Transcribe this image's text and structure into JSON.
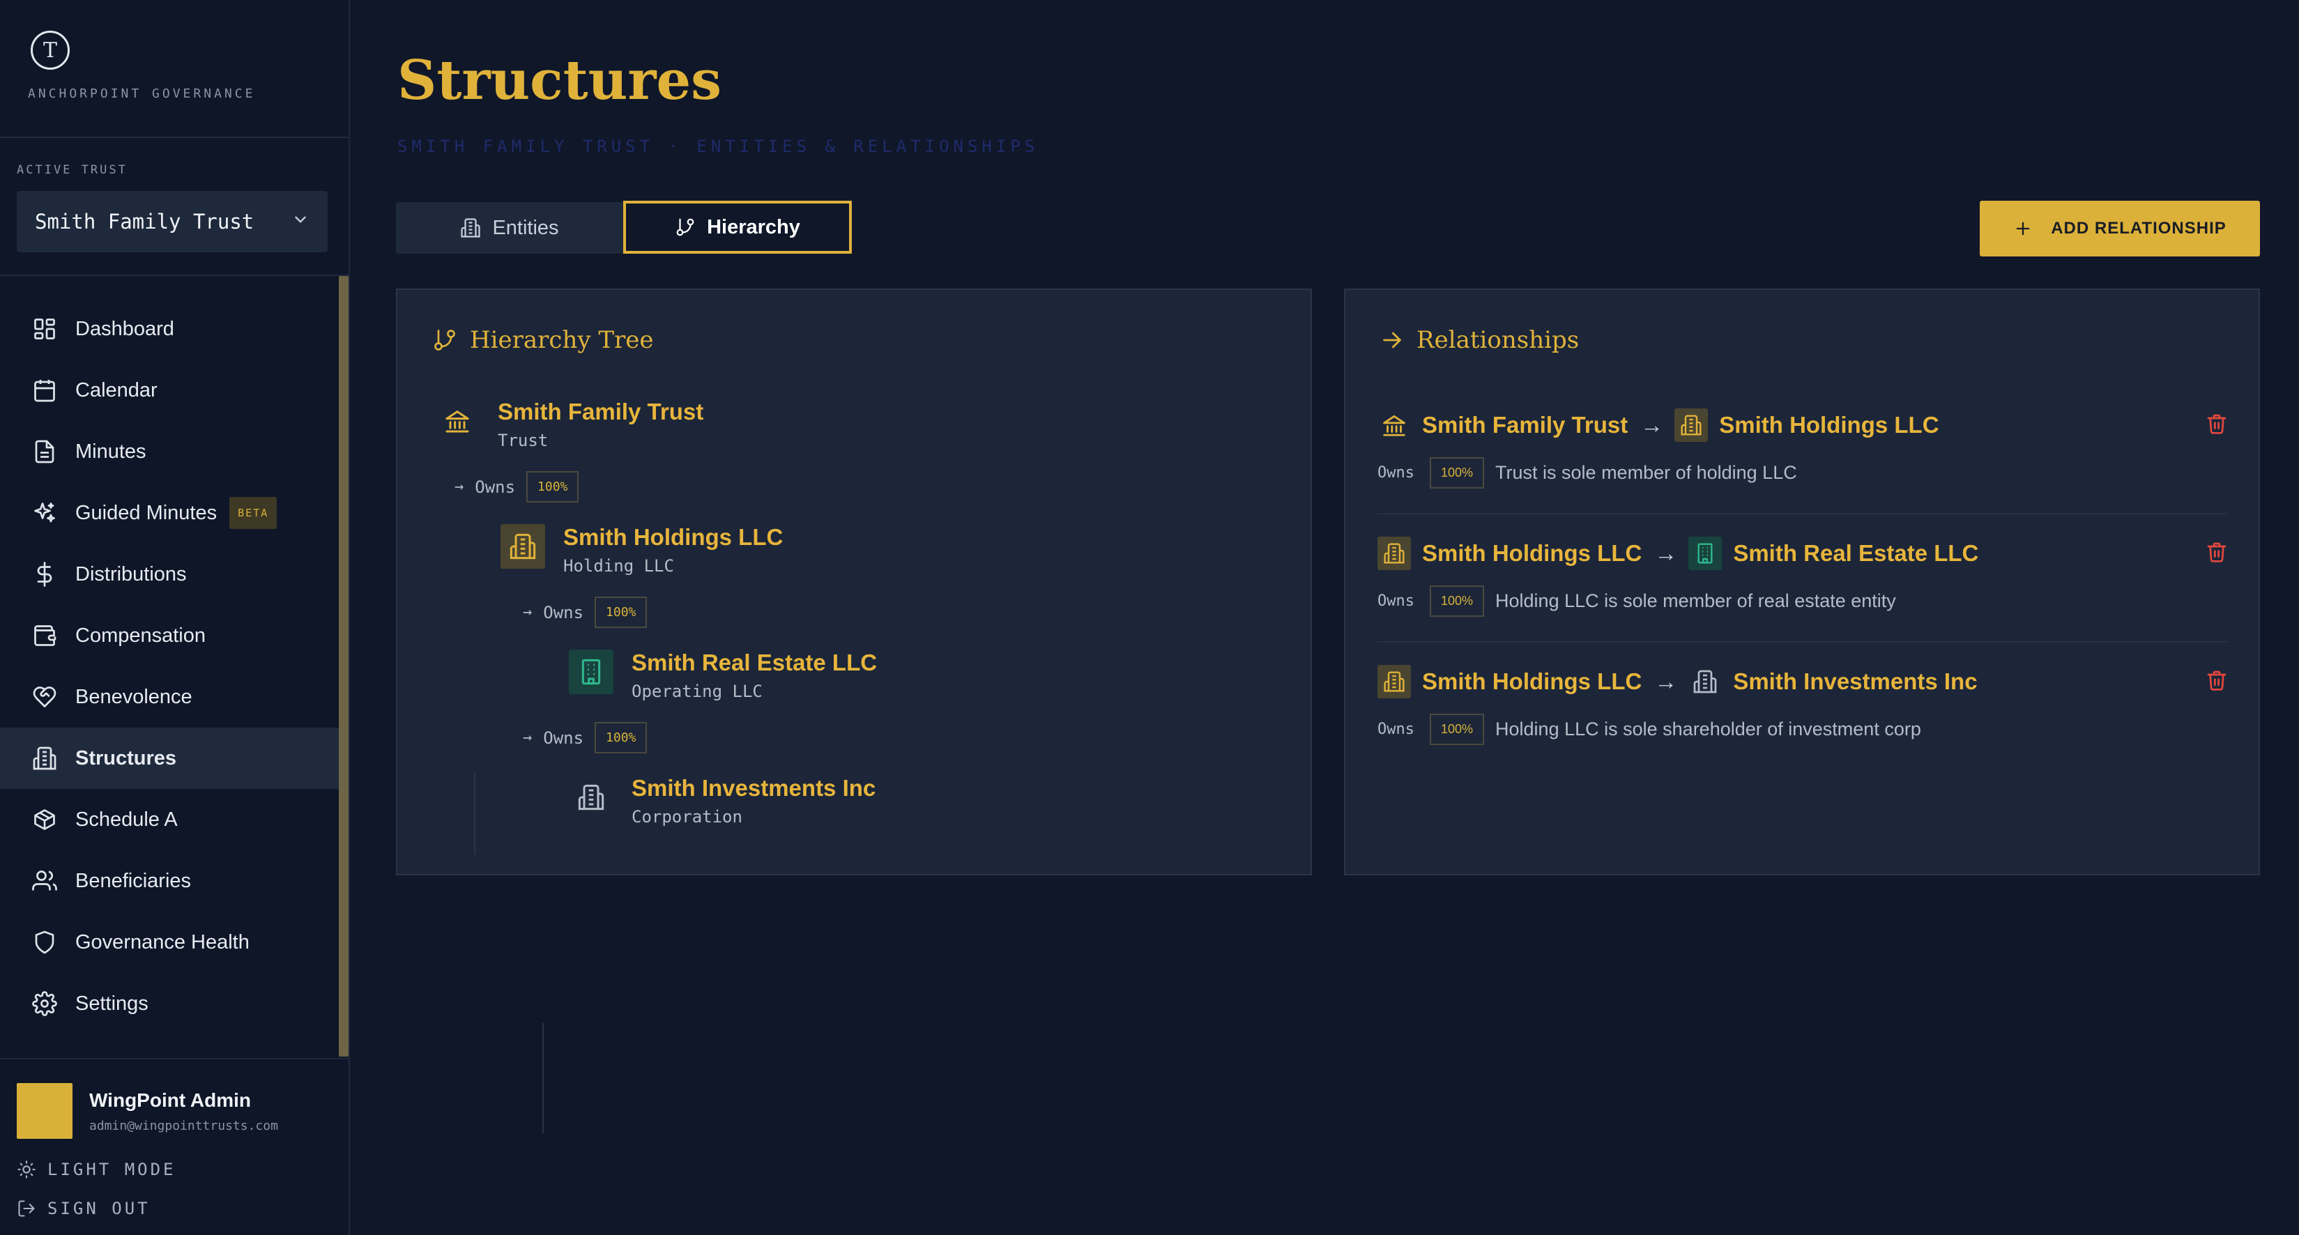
{
  "brand": {
    "logo_letter": "T",
    "name": "ANCHORPOINT GOVERNANCE"
  },
  "active_trust": {
    "label": "ACTIVE TRUST",
    "value": "Smith Family Trust"
  },
  "nav": [
    {
      "label": "Dashboard",
      "icon": "dashboard-icon"
    },
    {
      "label": "Calendar",
      "icon": "calendar-icon"
    },
    {
      "label": "Minutes",
      "icon": "document-icon"
    },
    {
      "label": "Guided Minutes",
      "icon": "sparkles-icon",
      "badge": "BETA"
    },
    {
      "label": "Distributions",
      "icon": "dollar-icon"
    },
    {
      "label": "Compensation",
      "icon": "wallet-icon"
    },
    {
      "label": "Benevolence",
      "icon": "heart-hand-icon"
    },
    {
      "label": "Structures",
      "icon": "building-icon",
      "active": true
    },
    {
      "label": "Schedule A",
      "icon": "package-icon"
    },
    {
      "label": "Beneficiaries",
      "icon": "users-icon"
    },
    {
      "label": "Governance Health",
      "icon": "shield-icon"
    },
    {
      "label": "Settings",
      "icon": "gear-icon"
    }
  ],
  "user": {
    "name": "WingPoint Admin",
    "email": "admin@wingpointtrusts.com"
  },
  "footer": {
    "light_mode": "LIGHT MODE",
    "sign_out": "SIGN OUT"
  },
  "page": {
    "title": "Structures",
    "subtitle": "SMITH FAMILY TRUST · ENTITIES & RELATIONSHIPS"
  },
  "tabs": {
    "entities": "Entities",
    "hierarchy": "Hierarchy",
    "active": "hierarchy"
  },
  "add_button": "ADD RELATIONSHIP",
  "hierarchy": {
    "title": "Hierarchy Tree",
    "root": {
      "name": "Smith Family Trust",
      "type": "Trust"
    },
    "edge1": {
      "label": "Owns",
      "pct": "100%"
    },
    "holding": {
      "name": "Smith Holdings LLC",
      "type": "Holding LLC"
    },
    "edge2": {
      "label": "Owns",
      "pct": "100%"
    },
    "real_estate": {
      "name": "Smith Real Estate LLC",
      "type": "Operating LLC"
    },
    "edge3": {
      "label": "Owns",
      "pct": "100%"
    },
    "investments": {
      "name": "Smith Investments Inc",
      "type": "Corporation"
    }
  },
  "relationships": {
    "title": "Relationships",
    "items": [
      {
        "from": "Smith Family Trust",
        "to": "Smith Holdings LLC",
        "label": "Owns",
        "pct": "100%",
        "note": "Trust is sole member of holding LLC"
      },
      {
        "from": "Smith Holdings LLC",
        "to": "Smith Real Estate LLC",
        "label": "Owns",
        "pct": "100%",
        "note": "Holding LLC is sole member of real estate entity"
      },
      {
        "from": "Smith Holdings LLC",
        "to": "Smith Investments Inc",
        "label": "Owns",
        "pct": "100%",
        "note": "Holding LLC is sole shareholder of investment corp"
      }
    ]
  },
  "colors": {
    "accent": "#e0b23a",
    "background": "#0f1729",
    "panel": "#1c2638",
    "danger": "#e5483f",
    "teal": "#1f8a6a"
  }
}
